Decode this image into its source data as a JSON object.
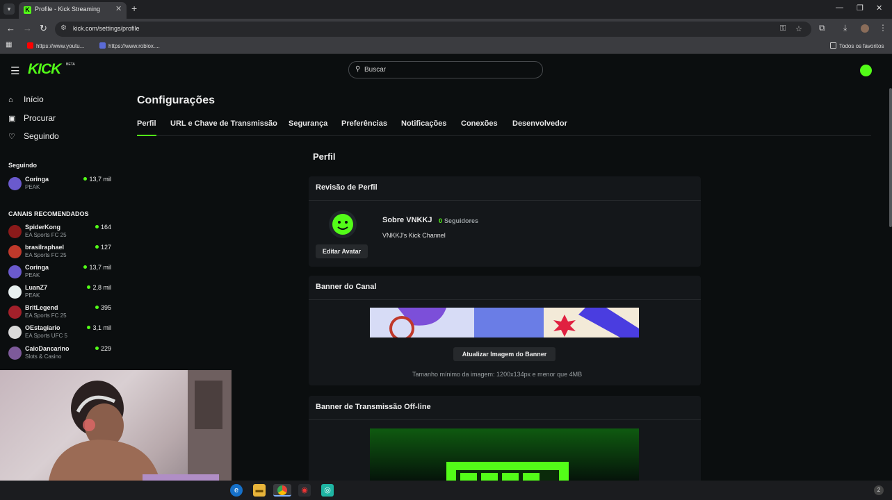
{
  "browser": {
    "tab_title": "Profile - Kick Streaming",
    "url": "kick.com/settings/profile",
    "bookmarks": [
      "https://www.youtu...",
      "https://www.roblox....",
      "Todos os favoritos"
    ]
  },
  "header": {
    "logo": "KICK",
    "logo_badge": "BETA",
    "search_placeholder": "Buscar"
  },
  "sidebar": {
    "nav": [
      {
        "label": "Início",
        "icon": "home-icon"
      },
      {
        "label": "Procurar",
        "icon": "browse-icon"
      },
      {
        "label": "Seguindo",
        "icon": "heart-icon"
      }
    ],
    "following_heading": "Seguindo",
    "following": [
      {
        "name": "Coringa",
        "category": "PEAK",
        "viewers": "13,7 mil",
        "color": "#6a5acd"
      }
    ],
    "recommended_heading": "CANAIS RECOMENDADOS",
    "recommended": [
      {
        "name": "SpiderKong",
        "category": "EA Sports FC 25",
        "viewers": "164",
        "color": "#8b1a1a"
      },
      {
        "name": "brasilraphael",
        "category": "EA Sports FC 25",
        "viewers": "127",
        "color": "#c0392b"
      },
      {
        "name": "Coringa",
        "category": "PEAK",
        "viewers": "13,7 mil",
        "color": "#6a5acd"
      },
      {
        "name": "LuanZ7",
        "category": "PEAK",
        "viewers": "2,8 mil",
        "color": "#e8f0f0"
      },
      {
        "name": "BritLegend",
        "category": "EA Sports FC 25",
        "viewers": "395",
        "color": "#a3202a"
      },
      {
        "name": "OEstagiario",
        "category": "EA Sports UFC 5",
        "viewers": "3,1 mil",
        "color": "#d9d9d9"
      },
      {
        "name": "CaioDancarino",
        "category": "Slots & Casino",
        "viewers": "229",
        "color": "#7d5a9a"
      }
    ]
  },
  "settings": {
    "title": "Configurações",
    "tabs": [
      "Perfil",
      "URL e Chave de Transmissão",
      "Segurança",
      "Preferências",
      "Notificações",
      "Conexões",
      "Desenvolvedor"
    ],
    "active_tab": "Perfil",
    "section_title": "Perfil",
    "review": {
      "heading": "Revisão de Perfil",
      "about": "Sobre VNKKJ",
      "followers_count": "0",
      "followers_label": "Seguidores",
      "bio": "VNKKJ's Kick Channel",
      "edit_avatar": "Editar Avatar"
    },
    "banner": {
      "heading": "Banner do Canal",
      "update_button": "Atualizar Imagem do Banner",
      "hint": "Tamanho mínimo da imagem: 1200x134px e menor que 4MB"
    },
    "offline_banner": {
      "heading": "Banner de Transmissão Off-line"
    }
  },
  "colors": {
    "accent": "#53fc18",
    "background": "#0b0e0f",
    "card": "#14171a"
  }
}
